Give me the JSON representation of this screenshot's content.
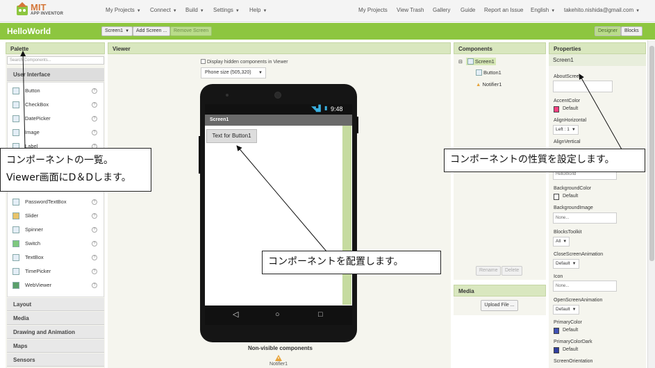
{
  "logo": {
    "title": "MIT",
    "subtitle": "APP INVENTOR"
  },
  "topmenu": {
    "left": [
      "My Projects",
      "Connect",
      "Build",
      "Settings",
      "Help"
    ],
    "right": [
      "My Projects",
      "View Trash",
      "Gallery",
      "Guide",
      "Report an Issue",
      "English"
    ],
    "user": "takehito.nishida@gmail.com"
  },
  "toolbar": {
    "project": "HelloWorld",
    "screen_select": "Screen1",
    "add_screen": "Add Screen ...",
    "remove_screen": "Remove Screen",
    "designer": "Designer",
    "blocks": "Blocks"
  },
  "palette": {
    "header": "Palette",
    "search_placeholder": "Search Components...",
    "category_open": "User Interface",
    "items": [
      "Button",
      "CheckBox",
      "DatePicker",
      "Image",
      "Label",
      "PasswordTextBox",
      "Slider",
      "Spinner",
      "Switch",
      "TextBox",
      "TimePicker",
      "WebViewer"
    ],
    "categories": [
      "Layout",
      "Media",
      "Drawing and Animation",
      "Maps",
      "Sensors"
    ]
  },
  "viewer": {
    "header": "Viewer",
    "hidden_checkbox": "Display hidden components in Viewer",
    "phone_size": "Phone size (505,320)",
    "time": "9:48",
    "screen_title": "Screen1",
    "button_text": "Text for Button1",
    "nonvisible_title": "Non-visible components",
    "nonvisible_item": "Notifier1"
  },
  "components": {
    "header": "Components",
    "tree": [
      "Screen1",
      "Button1",
      "Notifier1"
    ],
    "rename": "Rename",
    "delete": "Delete"
  },
  "media": {
    "header": "Media",
    "upload": "Upload File ..."
  },
  "properties": {
    "header": "Properties",
    "screen": "Screen1",
    "about": "AboutScreen",
    "accent_color": "AccentColor",
    "accent_value": "Default",
    "align_h": "AlignHorizontal",
    "align_h_value": "Left : 1",
    "align_v": "AlignVertical",
    "app_name_value": "HelloWorld",
    "bg_color": "BackgroundColor",
    "bg_color_value": "Default",
    "bg_image": "BackgroundImage",
    "bg_image_value": "None...",
    "blocks_toolkit": "BlocksToolkit",
    "blocks_toolkit_value": "All",
    "close_anim": "CloseScreenAnimation",
    "close_anim_value": "Default",
    "icon": "Icon",
    "icon_value": "None...",
    "open_anim": "OpenScreenAnimation",
    "open_anim_value": "Default",
    "primary_color": "PrimaryColor",
    "primary_color_value": "Default",
    "primary_dark": "PrimaryColorDark",
    "primary_dark_value": "Default",
    "orientation": "ScreenOrientation"
  },
  "annotations": {
    "palette_line1": "コンポーネントの一覧。",
    "palette_line2": "Viewer画面にD＆Dします。",
    "properties": "コンポーネントの性質を設定します。",
    "viewer": "コンポーネントを配置します。"
  },
  "colors": {
    "toolbar_green": "#8dc63f",
    "accent": "#ff4081",
    "primary": "#3f51b5",
    "primary_dark": "#303f9f"
  }
}
